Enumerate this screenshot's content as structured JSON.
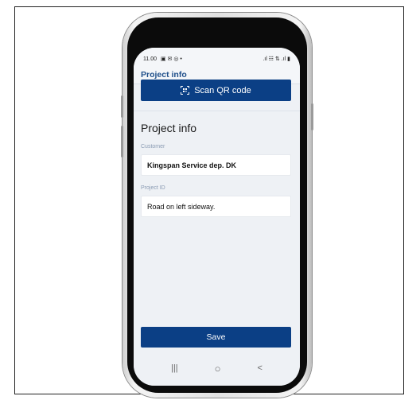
{
  "status_bar": {
    "time": "11.00",
    "left_icons": "▣ ✉ ◎ •",
    "right_icons": ".ıl ☷ ⇅ .ıl ▮"
  },
  "app_bar": {
    "title": "Project info"
  },
  "scan_button": {
    "label": "Scan QR code",
    "icon": "qr-scan-icon"
  },
  "form": {
    "section_title": "Project info",
    "customer": {
      "label": "Customer",
      "value": "Kingspan Service dep. DK"
    },
    "project_id": {
      "label": "Project ID",
      "value": "Road on left sideway."
    }
  },
  "save_button": {
    "label": "Save"
  },
  "nav_bar": {
    "recent": "|||",
    "home": "○",
    "back": "<"
  },
  "colors": {
    "primary": "#0b3f85",
    "title_blue": "#1f4f8a",
    "background": "#eef1f5",
    "label_gray": "#8a9bb3"
  }
}
